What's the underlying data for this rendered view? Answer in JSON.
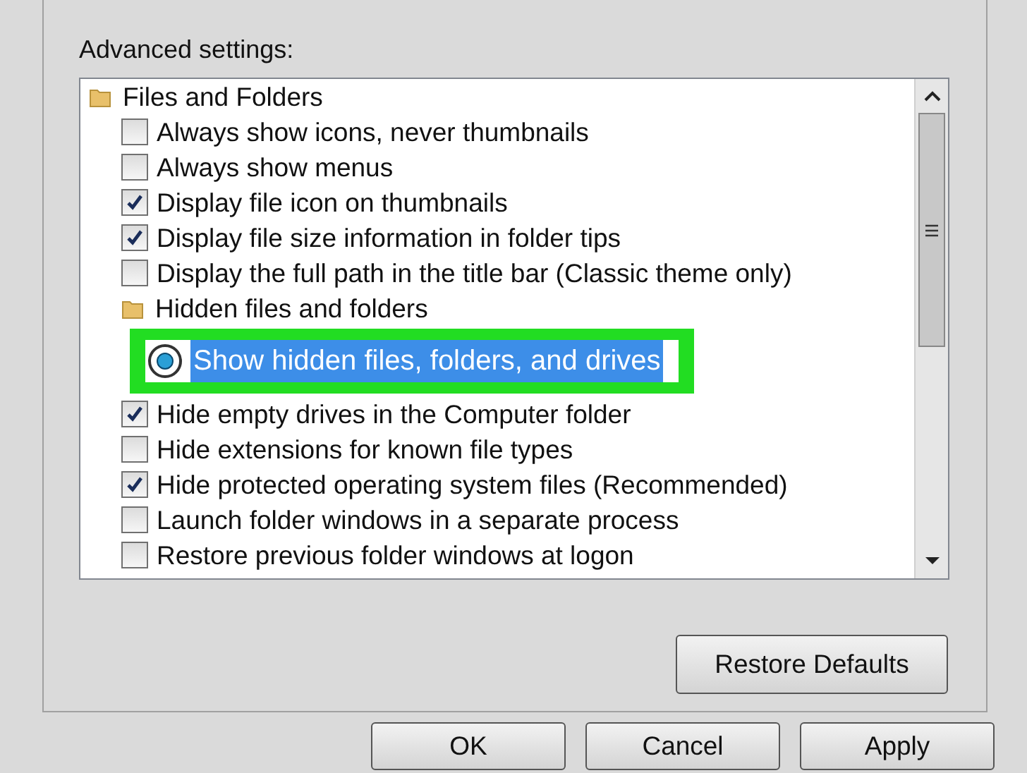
{
  "section_label": "Advanced settings:",
  "tree": [
    {
      "kind": "folder",
      "label": "Files and Folders",
      "children": [
        {
          "kind": "checkbox",
          "label": "Always show icons, never thumbnails",
          "checked": false
        },
        {
          "kind": "checkbox",
          "label": "Always show menus",
          "checked": false
        },
        {
          "kind": "checkbox",
          "label": "Display file icon on thumbnails",
          "checked": true
        },
        {
          "kind": "checkbox",
          "label": "Display file size information in folder tips",
          "checked": true
        },
        {
          "kind": "checkbox",
          "label": "Display the full path in the title bar (Classic theme only)",
          "checked": false
        },
        {
          "kind": "folder",
          "label": "Hidden files and folders",
          "children": [
            {
              "kind": "radio",
              "label": "Show hidden files, folders, and drives",
              "selected": true,
              "highlighted": true
            }
          ]
        },
        {
          "kind": "checkbox",
          "label": "Hide empty drives in the Computer folder",
          "checked": true
        },
        {
          "kind": "checkbox",
          "label": "Hide extensions for known file types",
          "checked": false
        },
        {
          "kind": "checkbox",
          "label": "Hide protected operating system files (Recommended)",
          "checked": true
        },
        {
          "kind": "checkbox",
          "label": "Launch folder windows in a separate process",
          "checked": false
        },
        {
          "kind": "checkbox",
          "label": "Restore previous folder windows at logon",
          "checked": false
        }
      ]
    }
  ],
  "restore_button": "Restore Defaults",
  "buttons": [
    "OK",
    "Cancel",
    "Apply"
  ]
}
